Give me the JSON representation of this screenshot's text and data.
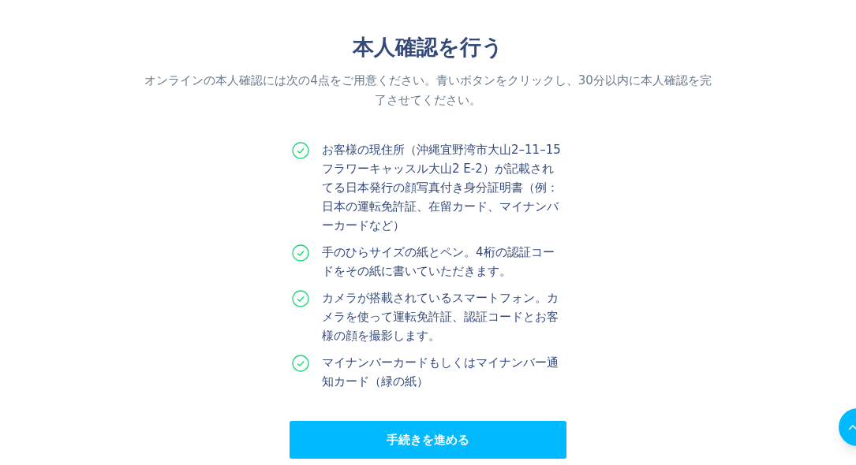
{
  "title": "本人確認を行う",
  "description": "オンラインの本人確認には次の4点をご用意ください。青いボタンをクリックし、30分以内に本人確認を完了させてください。",
  "requirements": [
    {
      "text": "お客様の現住所（沖縄宜野湾市大山2–11–15　フラワーキャッスル大山2 E-2）が記載されてる日本発行の顔写真付き身分証明書（例：日本の運転免許証、在留カード、マイナンバーカードなど）",
      "checked": true
    },
    {
      "text": "手のひらサイズの紙とペン。4桁の認証コードをその紙に書いていただきます。",
      "checked": true
    },
    {
      "text": "カメラが搭載されているスマートフォン。カメラを使って運転免許証、認証コードとお客様の顔を撮影します。",
      "checked": true
    },
    {
      "text": "マイナンバーカードもしくはマイナンバー通知カード（緑の紙）",
      "checked": true
    }
  ],
  "proceed_button": "手続きを進める"
}
